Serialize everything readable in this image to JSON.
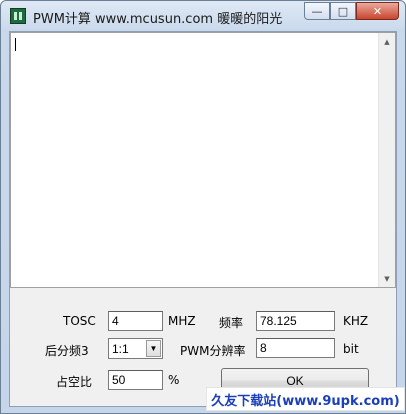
{
  "window": {
    "title": "PWM计算 www.mcusun.com  暖暖的阳光",
    "buttons": {
      "minimize": "—",
      "maximize": "□",
      "close": "✕"
    }
  },
  "output": {
    "text": ""
  },
  "form": {
    "tosc": {
      "label": "TOSC",
      "value": "4",
      "unit": "MHZ"
    },
    "freq": {
      "label": "频率",
      "value": "78.125",
      "unit": "KHZ"
    },
    "prescaler": {
      "label": "后分频3",
      "value": "1:1"
    },
    "resolution": {
      "label": "PWM分辨率",
      "value": "8",
      "unit": "bit"
    },
    "duty": {
      "label": "占空比",
      "value": "50",
      "unit": "%"
    },
    "ok_label": "OK"
  },
  "watermark": "久友下载站(www.9upk.com)",
  "icons": {
    "dropdown": "▼",
    "scroll_up": "▲",
    "scroll_down": "▼"
  }
}
